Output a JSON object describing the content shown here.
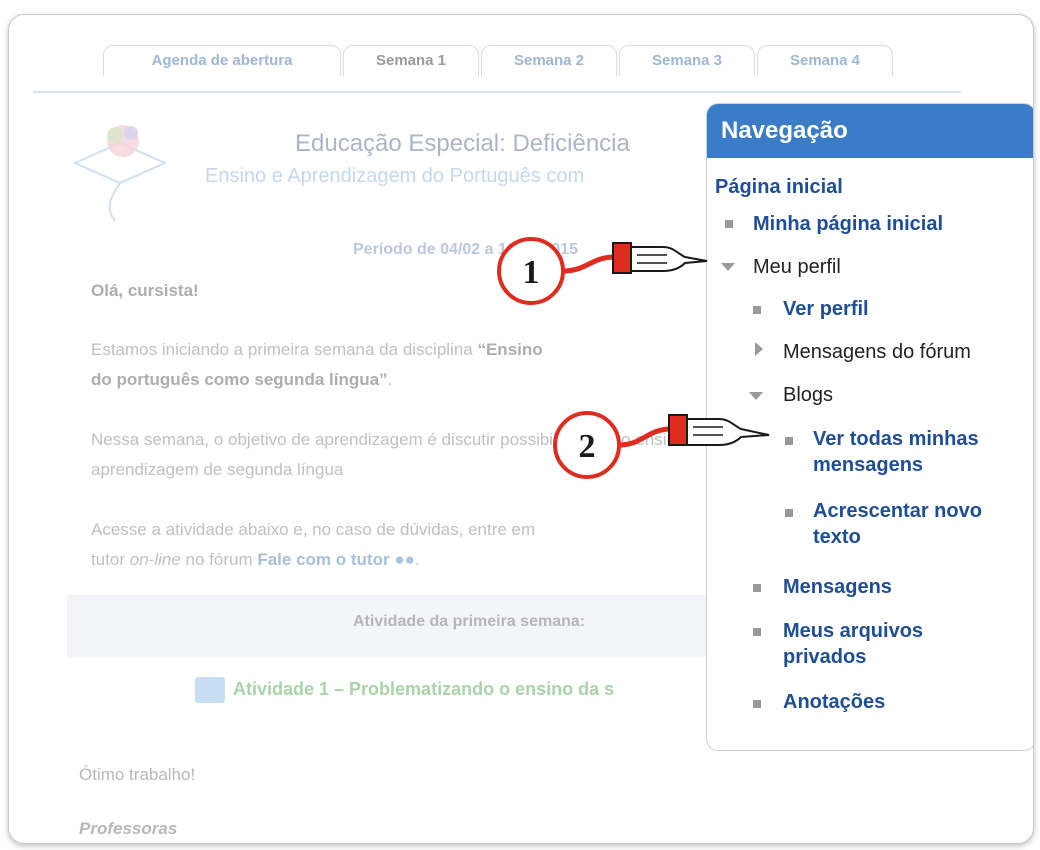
{
  "tabs": [
    "Agenda de abertura",
    "Semana 1",
    "Semana 2",
    "Semana 3",
    "Semana 4"
  ],
  "course": {
    "title": "Educação Especial: Deficiência",
    "subtitle": "Ensino e Aprendizagem do Português com",
    "periodo": "Período de 04/02 a 10/02/2015",
    "greeting": "Olá, cursista!",
    "p1_a": "Estamos iniciando a primeira semana da disciplina ",
    "p1_b": "“Ensino",
    "p1_c": "do português como segunda língua”",
    "p1_d": ".",
    "p2": "Nessa semana, o objetivo de aprendizagem é discutir possibilidades no ensino-aprendizagem de segunda língua",
    "p3_a": "Acesse a atividade abaixo e, no caso de dúvidas, entre em",
    "p3_b": "tutor ",
    "p3_c": "on-line",
    "p3_d": " no fórum ",
    "p3_link": "Fale com o tutor",
    "p3_e": ".",
    "activity_header": "Atividade da primeira semana:",
    "activity_1": "Atividade 1 – Problematizando o ensino da s",
    "closing": "Ótimo trabalho!",
    "signature": "Professoras"
  },
  "nav": {
    "title": "Navegação",
    "home": "Página inicial",
    "items": {
      "minha_pagina": "Minha página inicial",
      "meu_perfil": "Meu perfil",
      "ver_perfil": "Ver perfil",
      "mensagens_forum": "Mensagens do fórum",
      "blogs": "Blogs",
      "ver_todas_1": "Ver todas minhas",
      "ver_todas_2": "mensagens",
      "acrescentar_1": "Acrescentar novo",
      "acrescentar_2": "texto",
      "mensagens": "Mensagens",
      "arquivos_1": "Meus arquivos",
      "arquivos_2": "privados",
      "anotacoes": "Anotações"
    }
  },
  "callouts": [
    "1",
    "2"
  ],
  "colors": {
    "nav_header": "#3a7cc5",
    "link": "#1f4e96",
    "callout_red": "#e02b1f"
  }
}
